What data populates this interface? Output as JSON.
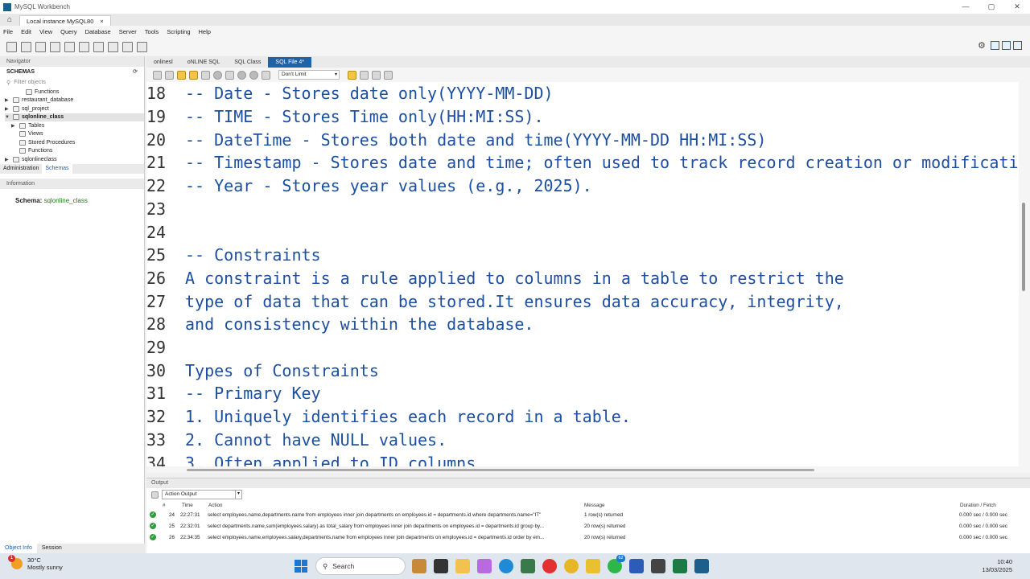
{
  "window": {
    "title": "MySQL Workbench"
  },
  "connection_tab": {
    "label": "Local instance MySQL80",
    "close": "×"
  },
  "window_controls": {
    "minimize": "—",
    "maximize": "▢",
    "close": "✕"
  },
  "menu": [
    "File",
    "Edit",
    "View",
    "Query",
    "Database",
    "Server",
    "Tools",
    "Scripting",
    "Help"
  ],
  "navigator": {
    "header": "Navigator",
    "schemas_label": "SCHEMAS",
    "filter_placeholder": "Filter objects",
    "tree": [
      {
        "label": "Functions",
        "indent": 2,
        "arrow": ""
      },
      {
        "label": "restaurant_database",
        "indent": 0,
        "arrow": "▶"
      },
      {
        "label": "sql_project",
        "indent": 0,
        "arrow": "▶"
      },
      {
        "label": "sqlonline_class",
        "indent": 0,
        "arrow": "▼",
        "selected": true
      },
      {
        "label": "Tables",
        "indent": 1,
        "arrow": "▶"
      },
      {
        "label": "Views",
        "indent": 1,
        "arrow": ""
      },
      {
        "label": "Stored Procedures",
        "indent": 1,
        "arrow": ""
      },
      {
        "label": "Functions",
        "indent": 1,
        "arrow": ""
      },
      {
        "label": "sqlonlineclass",
        "indent": 0,
        "arrow": "▶"
      }
    ],
    "tabs": [
      "Administration",
      "Schemas"
    ],
    "info_header": "Information",
    "schema_label": "Schema:",
    "schema_value": "sqlonline_class",
    "bottom_tabs": [
      "Object Info",
      "Session"
    ]
  },
  "query_tabs": [
    "onlinesl",
    "oNLINE SQL",
    "SQL Class",
    "SQL File 4*"
  ],
  "limit_select": "Don't Limit",
  "editor_lines": [
    {
      "num": "18",
      "text": "-- Date - Stores date only(YYYY-MM-DD)"
    },
    {
      "num": "19",
      "text": "-- TIME - Stores Time only(HH:MI:SS)."
    },
    {
      "num": "20",
      "text": "-- DateTime - Stores both date and time(YYYY-MM-DD HH:MI:SS)"
    },
    {
      "num": "21",
      "text": "-- Timestamp - Stores date and time; often used to track record creation or modificati"
    },
    {
      "num": "22",
      "text": "-- Year - Stores year values (e.g., 2025)."
    },
    {
      "num": "23",
      "text": ""
    },
    {
      "num": "24",
      "text": ""
    },
    {
      "num": "25",
      "text": "-- Constraints"
    },
    {
      "num": "26",
      "text": "A constraint is a rule applied to columns in a table to restrict the"
    },
    {
      "num": "27",
      "text": "type of data that can be stored.It ensures data accuracy, integrity,"
    },
    {
      "num": "28",
      "text": "and consistency within the database."
    },
    {
      "num": "29",
      "text": ""
    },
    {
      "num": "30",
      "text": "Types of Constraints"
    },
    {
      "num": "31",
      "text": "-- Primary Key"
    },
    {
      "num": "32",
      "text": "1. Uniquely identifies each record in a table."
    },
    {
      "num": "33",
      "text": "2. Cannot have NULL values."
    },
    {
      "num": "34",
      "text": "3. Often applied to ID columns"
    }
  ],
  "output": {
    "header": "Output",
    "select": "Action Output",
    "columns": {
      "num": "#",
      "time": "Time",
      "action": "Action",
      "message": "Message",
      "duration": "Duration / Fetch"
    },
    "rows": [
      {
        "num": "24",
        "time": "22:27:31",
        "action": "select employees.name,departments.name from employees inner join departments on employees.id = departments.id where departments.name=\"IT\"",
        "message": "1 row(s) returned",
        "duration": "0.000 sec / 0.000 sec"
      },
      {
        "num": "25",
        "time": "22:32:01",
        "action": "select departments.name,sum(employees.salary) as total_salary from employees inner join departments on employees.id = departments.id group by...",
        "message": "20 row(s) returned",
        "duration": "0.000 sec / 0.000 sec"
      },
      {
        "num": "26",
        "time": "22:34:35",
        "action": "select employees.name,employees.salary,departments.name from employees inner join departments on employees.id = departments.id order by em...",
        "message": "20 row(s) returned",
        "duration": "0.000 sec / 0.000 sec"
      }
    ]
  },
  "taskbar": {
    "weather_temp": "30°C",
    "weather_desc": "Mostly sunny",
    "weather_badge": "1",
    "search_label": "Search",
    "whatsapp_badge": "62",
    "time": "10:40",
    "date": "13/03/2025"
  },
  "colors": {
    "accent": "#1e62a8",
    "code": "#1d4fa0",
    "ok": "#2e9c3a"
  }
}
